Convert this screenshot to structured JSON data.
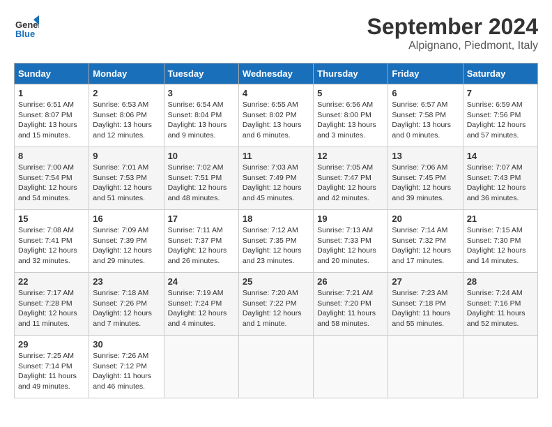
{
  "logo": {
    "general": "General",
    "blue": "Blue"
  },
  "title": "September 2024",
  "subtitle": "Alpignano, Piedmont, Italy",
  "headers": [
    "Sunday",
    "Monday",
    "Tuesday",
    "Wednesday",
    "Thursday",
    "Friday",
    "Saturday"
  ],
  "weeks": [
    [
      {
        "day": "1",
        "info": "Sunrise: 6:51 AM\nSunset: 8:07 PM\nDaylight: 13 hours\nand 15 minutes."
      },
      {
        "day": "2",
        "info": "Sunrise: 6:53 AM\nSunset: 8:06 PM\nDaylight: 13 hours\nand 12 minutes."
      },
      {
        "day": "3",
        "info": "Sunrise: 6:54 AM\nSunset: 8:04 PM\nDaylight: 13 hours\nand 9 minutes."
      },
      {
        "day": "4",
        "info": "Sunrise: 6:55 AM\nSunset: 8:02 PM\nDaylight: 13 hours\nand 6 minutes."
      },
      {
        "day": "5",
        "info": "Sunrise: 6:56 AM\nSunset: 8:00 PM\nDaylight: 13 hours\nand 3 minutes."
      },
      {
        "day": "6",
        "info": "Sunrise: 6:57 AM\nSunset: 7:58 PM\nDaylight: 13 hours\nand 0 minutes."
      },
      {
        "day": "7",
        "info": "Sunrise: 6:59 AM\nSunset: 7:56 PM\nDaylight: 12 hours\nand 57 minutes."
      }
    ],
    [
      {
        "day": "8",
        "info": "Sunrise: 7:00 AM\nSunset: 7:54 PM\nDaylight: 12 hours\nand 54 minutes."
      },
      {
        "day": "9",
        "info": "Sunrise: 7:01 AM\nSunset: 7:53 PM\nDaylight: 12 hours\nand 51 minutes."
      },
      {
        "day": "10",
        "info": "Sunrise: 7:02 AM\nSunset: 7:51 PM\nDaylight: 12 hours\nand 48 minutes."
      },
      {
        "day": "11",
        "info": "Sunrise: 7:03 AM\nSunset: 7:49 PM\nDaylight: 12 hours\nand 45 minutes."
      },
      {
        "day": "12",
        "info": "Sunrise: 7:05 AM\nSunset: 7:47 PM\nDaylight: 12 hours\nand 42 minutes."
      },
      {
        "day": "13",
        "info": "Sunrise: 7:06 AM\nSunset: 7:45 PM\nDaylight: 12 hours\nand 39 minutes."
      },
      {
        "day": "14",
        "info": "Sunrise: 7:07 AM\nSunset: 7:43 PM\nDaylight: 12 hours\nand 36 minutes."
      }
    ],
    [
      {
        "day": "15",
        "info": "Sunrise: 7:08 AM\nSunset: 7:41 PM\nDaylight: 12 hours\nand 32 minutes."
      },
      {
        "day": "16",
        "info": "Sunrise: 7:09 AM\nSunset: 7:39 PM\nDaylight: 12 hours\nand 29 minutes."
      },
      {
        "day": "17",
        "info": "Sunrise: 7:11 AM\nSunset: 7:37 PM\nDaylight: 12 hours\nand 26 minutes."
      },
      {
        "day": "18",
        "info": "Sunrise: 7:12 AM\nSunset: 7:35 PM\nDaylight: 12 hours\nand 23 minutes."
      },
      {
        "day": "19",
        "info": "Sunrise: 7:13 AM\nSunset: 7:33 PM\nDaylight: 12 hours\nand 20 minutes."
      },
      {
        "day": "20",
        "info": "Sunrise: 7:14 AM\nSunset: 7:32 PM\nDaylight: 12 hours\nand 17 minutes."
      },
      {
        "day": "21",
        "info": "Sunrise: 7:15 AM\nSunset: 7:30 PM\nDaylight: 12 hours\nand 14 minutes."
      }
    ],
    [
      {
        "day": "22",
        "info": "Sunrise: 7:17 AM\nSunset: 7:28 PM\nDaylight: 12 hours\nand 11 minutes."
      },
      {
        "day": "23",
        "info": "Sunrise: 7:18 AM\nSunset: 7:26 PM\nDaylight: 12 hours\nand 7 minutes."
      },
      {
        "day": "24",
        "info": "Sunrise: 7:19 AM\nSunset: 7:24 PM\nDaylight: 12 hours\nand 4 minutes."
      },
      {
        "day": "25",
        "info": "Sunrise: 7:20 AM\nSunset: 7:22 PM\nDaylight: 12 hours\nand 1 minute."
      },
      {
        "day": "26",
        "info": "Sunrise: 7:21 AM\nSunset: 7:20 PM\nDaylight: 11 hours\nand 58 minutes."
      },
      {
        "day": "27",
        "info": "Sunrise: 7:23 AM\nSunset: 7:18 PM\nDaylight: 11 hours\nand 55 minutes."
      },
      {
        "day": "28",
        "info": "Sunrise: 7:24 AM\nSunset: 7:16 PM\nDaylight: 11 hours\nand 52 minutes."
      }
    ],
    [
      {
        "day": "29",
        "info": "Sunrise: 7:25 AM\nSunset: 7:14 PM\nDaylight: 11 hours\nand 49 minutes."
      },
      {
        "day": "30",
        "info": "Sunrise: 7:26 AM\nSunset: 7:12 PM\nDaylight: 11 hours\nand 46 minutes."
      },
      {
        "day": "",
        "info": ""
      },
      {
        "day": "",
        "info": ""
      },
      {
        "day": "",
        "info": ""
      },
      {
        "day": "",
        "info": ""
      },
      {
        "day": "",
        "info": ""
      }
    ]
  ]
}
